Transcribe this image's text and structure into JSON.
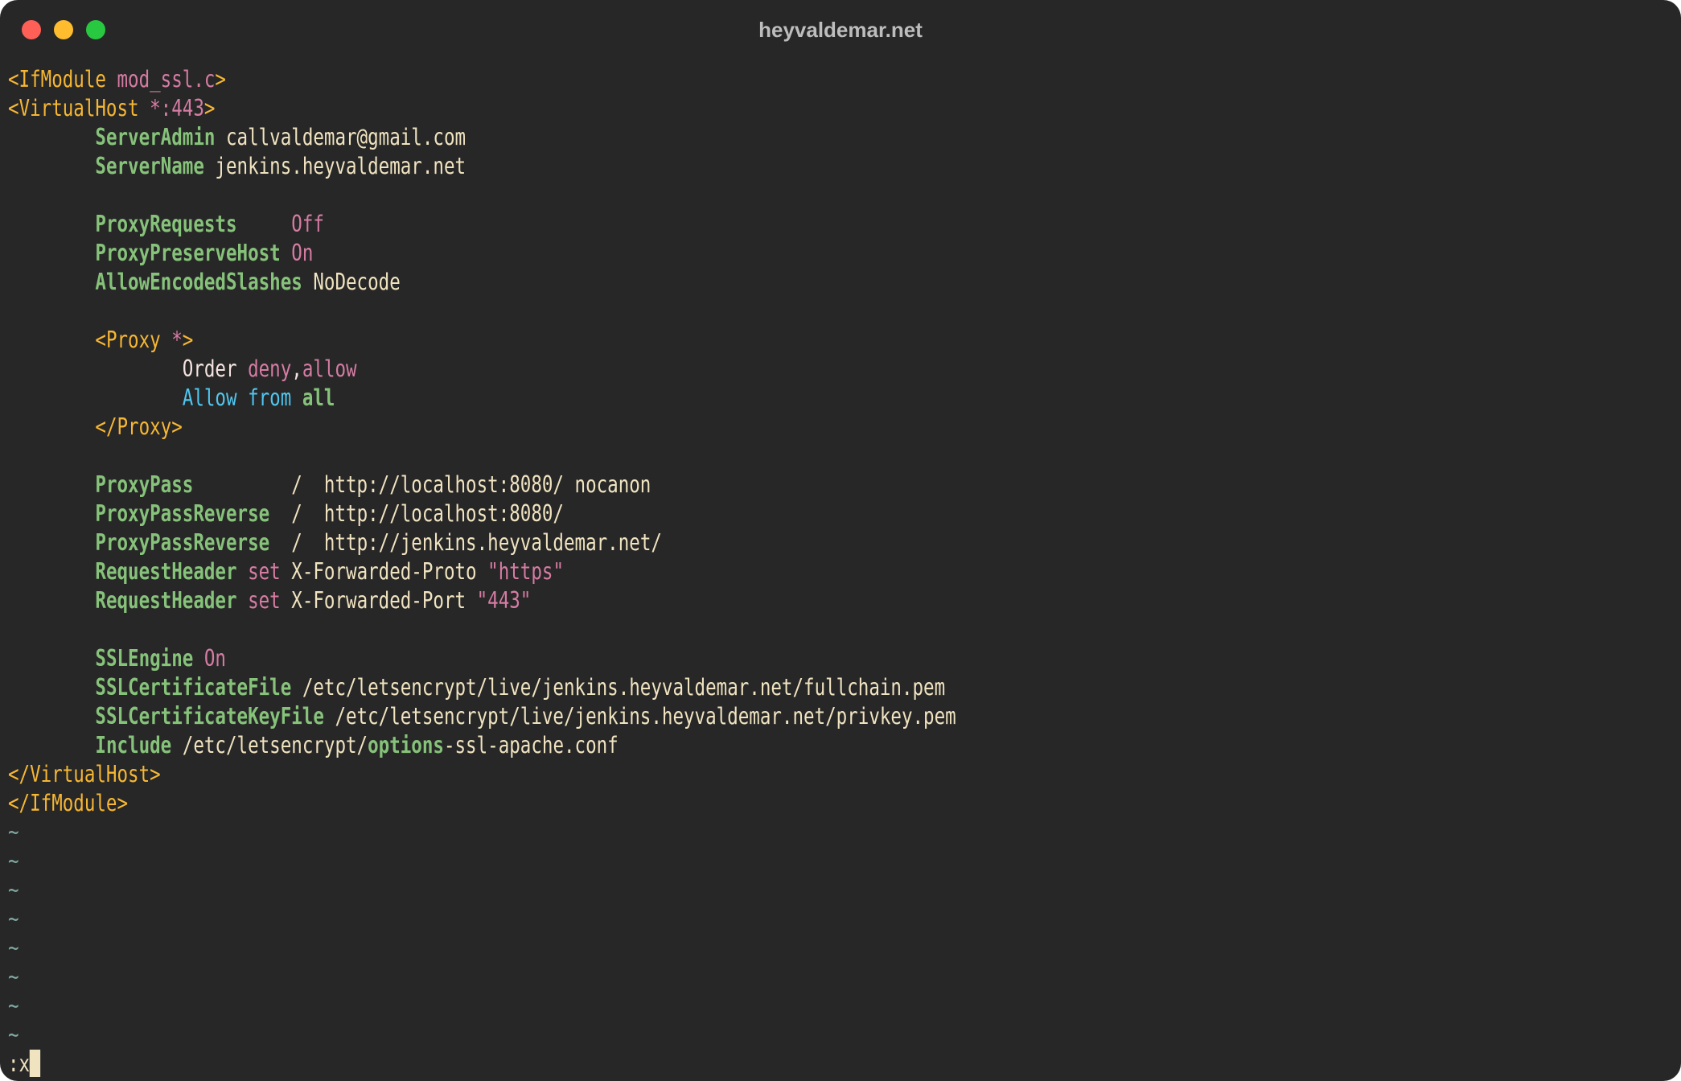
{
  "window": {
    "title": "heyvaldemar.net",
    "traffic_lights": [
      "close",
      "minimize",
      "zoom"
    ]
  },
  "editor": {
    "lines": [
      [
        {
          "t": "<IfModule ",
          "c": "tag"
        },
        {
          "t": "mod_ssl.c",
          "c": "attr"
        },
        {
          "t": ">",
          "c": "tag"
        }
      ],
      [
        {
          "t": "<VirtualHost ",
          "c": "tag"
        },
        {
          "t": "*:443",
          "c": "attr"
        },
        {
          "t": ">",
          "c": "tag"
        }
      ],
      [
        {
          "t": "        "
        },
        {
          "t": "ServerAdmin",
          "c": "dir"
        },
        {
          "t": " callvaldemar@gmail.com",
          "c": "val"
        }
      ],
      [
        {
          "t": "        "
        },
        {
          "t": "ServerName",
          "c": "dir"
        },
        {
          "t": " jenkins.heyvaldemar.net",
          "c": "val"
        }
      ],
      [],
      [
        {
          "t": "        "
        },
        {
          "t": "ProxyRequests",
          "c": "dir"
        },
        {
          "t": "     "
        },
        {
          "t": "Off",
          "c": "attr"
        }
      ],
      [
        {
          "t": "        "
        },
        {
          "t": "ProxyPreserveHost",
          "c": "dir"
        },
        {
          "t": " "
        },
        {
          "t": "On",
          "c": "attr"
        }
      ],
      [
        {
          "t": "        "
        },
        {
          "t": "AllowEncodedSlashes",
          "c": "dir"
        },
        {
          "t": " NoDecode",
          "c": "val"
        }
      ],
      [],
      [
        {
          "t": "        "
        },
        {
          "t": "<Proxy ",
          "c": "tag"
        },
        {
          "t": "*",
          "c": "attr"
        },
        {
          "t": ">",
          "c": "tag"
        }
      ],
      [
        {
          "t": "                "
        },
        {
          "t": "Order",
          "c": "order"
        },
        {
          "t": " "
        },
        {
          "t": "deny",
          "c": "attr"
        },
        {
          "t": ",",
          "c": "order"
        },
        {
          "t": "allow",
          "c": "attr"
        }
      ],
      [
        {
          "t": "                "
        },
        {
          "t": "Allow from",
          "c": "allowk"
        },
        {
          "t": " "
        },
        {
          "t": "all",
          "c": "dir"
        }
      ],
      [
        {
          "t": "        "
        },
        {
          "t": "</Proxy>",
          "c": "tag"
        }
      ],
      [],
      [
        {
          "t": "        "
        },
        {
          "t": "ProxyPass",
          "c": "dir"
        },
        {
          "t": "         /  http://localhost:8080/ nocanon",
          "c": "val"
        }
      ],
      [
        {
          "t": "        "
        },
        {
          "t": "ProxyPassReverse",
          "c": "dir"
        },
        {
          "t": "  /  http://localhost:8080/",
          "c": "val"
        }
      ],
      [
        {
          "t": "        "
        },
        {
          "t": "ProxyPassReverse",
          "c": "dir"
        },
        {
          "t": "  /  http://jenkins.heyvaldemar.net/",
          "c": "val"
        }
      ],
      [
        {
          "t": "        "
        },
        {
          "t": "RequestHeader",
          "c": "dir"
        },
        {
          "t": " "
        },
        {
          "t": "set",
          "c": "attr"
        },
        {
          "t": " X-Forwarded-Proto ",
          "c": "val"
        },
        {
          "t": "\"https\"",
          "c": "attr"
        }
      ],
      [
        {
          "t": "        "
        },
        {
          "t": "RequestHeader",
          "c": "dir"
        },
        {
          "t": " "
        },
        {
          "t": "set",
          "c": "attr"
        },
        {
          "t": " X-Forwarded-Port ",
          "c": "val"
        },
        {
          "t": "\"443\"",
          "c": "attr"
        }
      ],
      [],
      [
        {
          "t": "        "
        },
        {
          "t": "SSLEngine",
          "c": "dir"
        },
        {
          "t": " "
        },
        {
          "t": "On",
          "c": "attr"
        }
      ],
      [
        {
          "t": "        "
        },
        {
          "t": "SSLCertificateFile",
          "c": "dir"
        },
        {
          "t": " /etc/letsencrypt/live/jenkins.heyvaldemar.net/fullchain.pem",
          "c": "val"
        }
      ],
      [
        {
          "t": "        "
        },
        {
          "t": "SSLCertificateKeyFile",
          "c": "dir"
        },
        {
          "t": " /etc/letsencrypt/live/jenkins.heyvaldemar.net/privkey.pem",
          "c": "val"
        }
      ],
      [
        {
          "t": "        "
        },
        {
          "t": "Include",
          "c": "dir"
        },
        {
          "t": " /etc/letsencrypt/",
          "c": "val"
        },
        {
          "t": "options",
          "c": "dir"
        },
        {
          "t": "-ssl-apache.conf",
          "c": "val"
        }
      ],
      [
        {
          "t": "</VirtualHost>",
          "c": "tag"
        }
      ],
      [
        {
          "t": "</IfModule>",
          "c": "tag"
        }
      ]
    ],
    "empty_line_marker": "~",
    "empty_line_count": 8,
    "command_line": ":x"
  }
}
